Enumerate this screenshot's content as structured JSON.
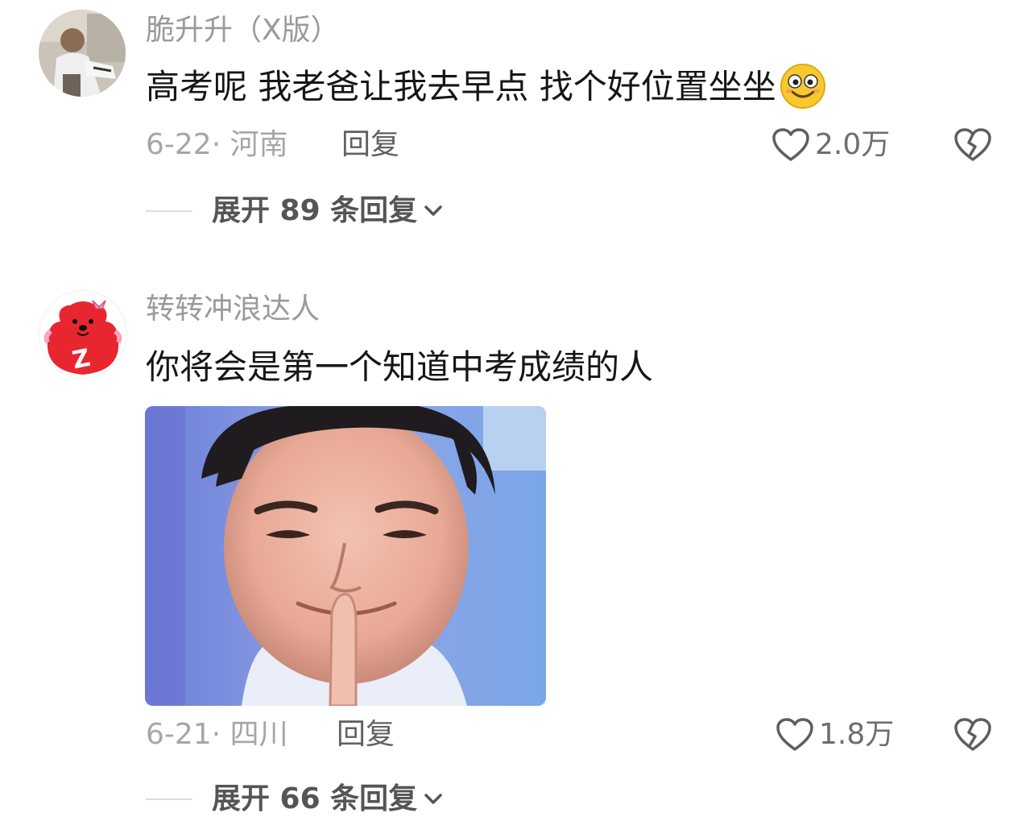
{
  "comments": [
    {
      "username": "脆升升（X版）",
      "text": "高考呢 我老爸让我去早点 找个好位置坐坐",
      "emoji": "smile-emoji",
      "date_location": "6-22· 河南",
      "reply_label": "回复",
      "likes": "2.0万",
      "expand_label": "展开 89 条回复"
    },
    {
      "username": "转转冲浪达人",
      "text": "你将会是第一个知道中考成绩的人",
      "media": "smirking-man-meme-image",
      "date_location": "6-21· 四川",
      "reply_label": "回复",
      "likes": "1.8万",
      "expand_label": "展开 66 条回复"
    }
  ],
  "colors": {
    "username": "#9a9a9a",
    "text": "#161616",
    "meta": "#a6a6a6",
    "avatar2_bg": "#e8262f"
  },
  "icons": [
    "heart-outline-icon",
    "broken-heart-icon",
    "chevron-down-icon"
  ]
}
